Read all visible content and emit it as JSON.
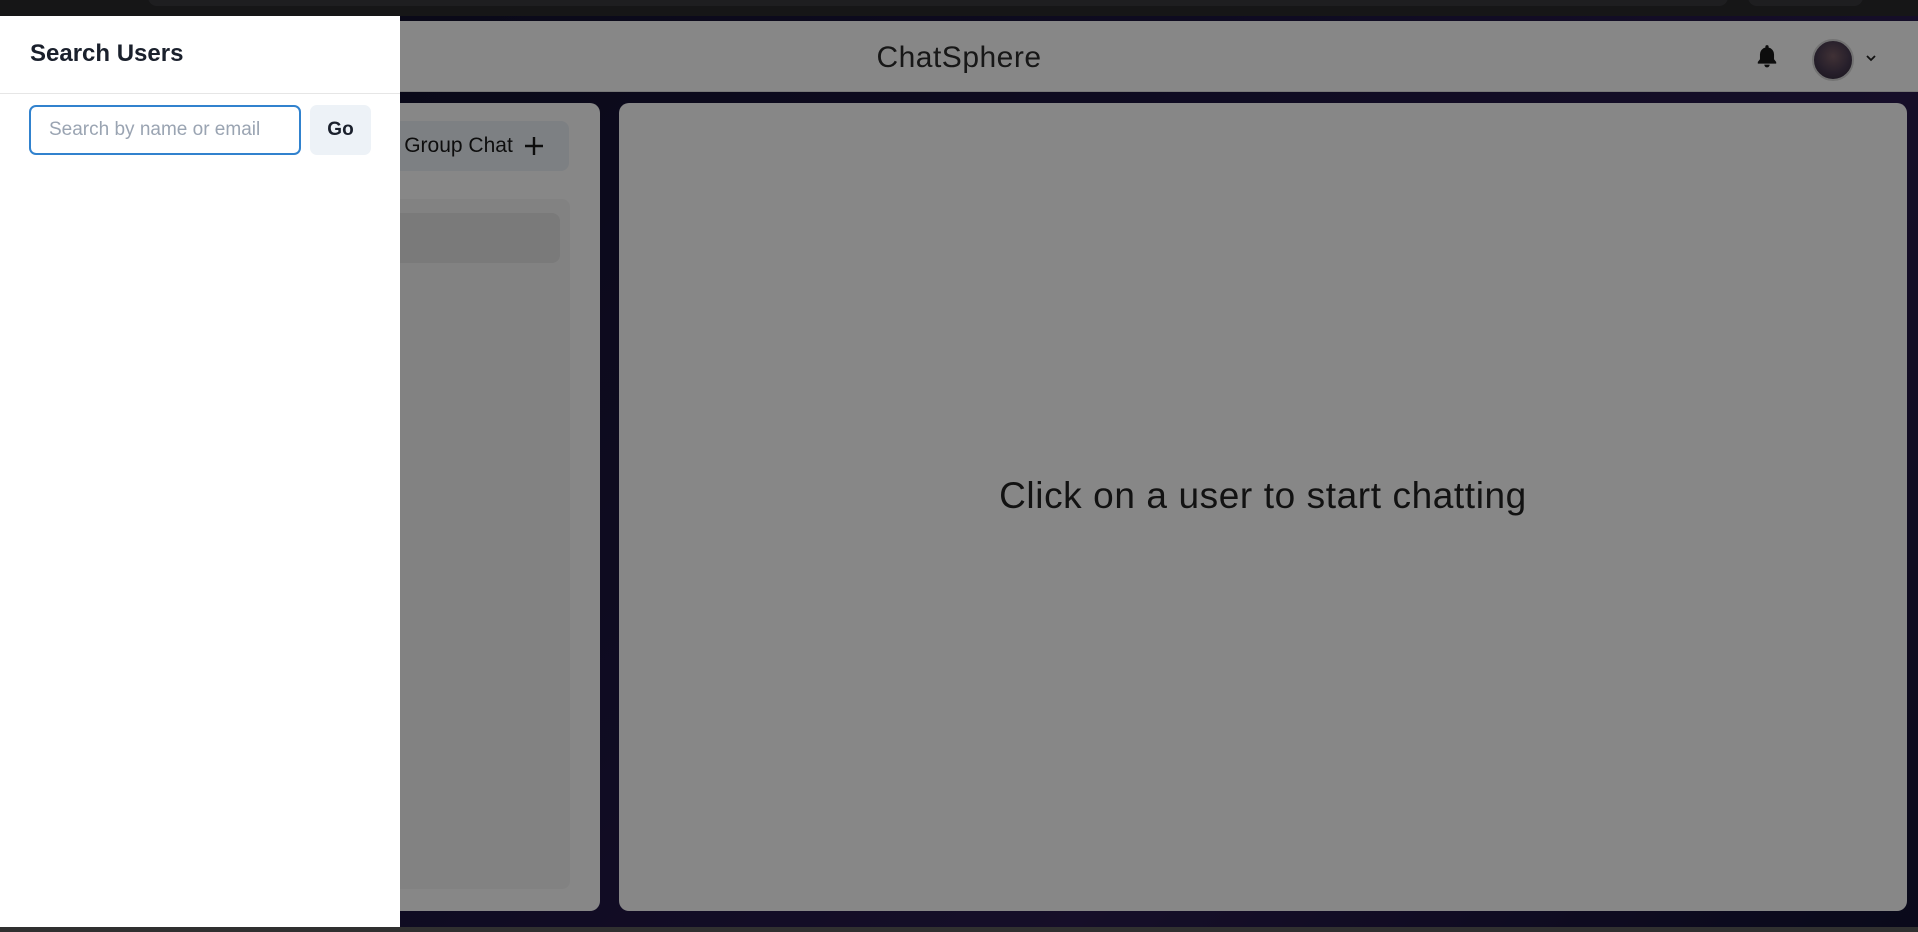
{
  "header": {
    "app_title": "ChatSphere",
    "notification_icon": "bell-icon",
    "profile_menu_icon": "chevron-down-icon"
  },
  "sidebar": {
    "new_group_button_label": "Group Chat",
    "new_group_button_icon": "plus-icon"
  },
  "chat_area": {
    "empty_message": "Click on a user to start chatting"
  },
  "search_drawer": {
    "title": "Search Users",
    "search_placeholder": "Search by name or email",
    "search_value": "",
    "go_label": "Go"
  },
  "colors": {
    "accent": "#3182ce",
    "overlay": "rgba(0,0,0,0.47)"
  }
}
